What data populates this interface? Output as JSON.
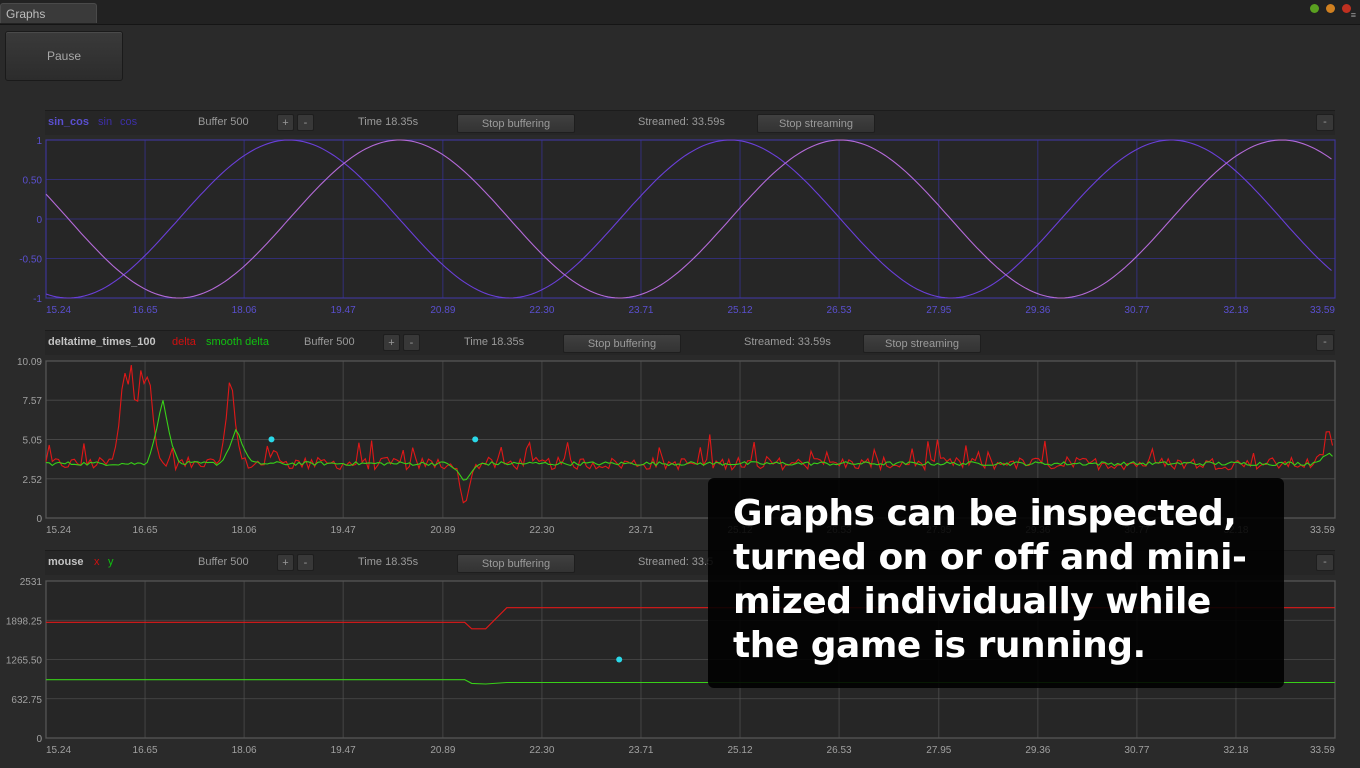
{
  "window": {
    "tab_label": "Graphs"
  },
  "pause_label": "Pause",
  "graphs": [
    {
      "name": "sin_cos",
      "series": [
        {
          "name": "sin",
          "color": "#3d2fa8"
        },
        {
          "name": "cos",
          "color": "#3d2fa8"
        }
      ],
      "buffer_label": "Buffer 500",
      "plus_label": "+",
      "minus_label": "-",
      "time_label": "Time 18.35s",
      "stop_buffering_label": "Stop buffering",
      "streamed_label": "Streamed: 33.59s",
      "stop_streaming_label": "Stop streaming",
      "minimize_label": "-"
    },
    {
      "name": "deltatime_times_100",
      "series": [
        {
          "name": "delta",
          "color": "#d01010"
        },
        {
          "name": "smooth delta",
          "color": "#10c010"
        }
      ],
      "buffer_label": "Buffer 500",
      "plus_label": "+",
      "minus_label": "-",
      "time_label": "Time 18.35s",
      "stop_buffering_label": "Stop buffering",
      "streamed_label": "Streamed: 33.59s",
      "stop_streaming_label": "Stop streaming",
      "minimize_label": "-"
    },
    {
      "name": "mouse",
      "series": [
        {
          "name": "x",
          "color": "#d01010"
        },
        {
          "name": "y",
          "color": "#10c010"
        }
      ],
      "buffer_label": "Buffer 500",
      "plus_label": "+",
      "minus_label": "-",
      "time_label": "Time 18.35s",
      "stop_buffering_label": "Stop buffering",
      "streamed_label": "Streamed: 33.5",
      "minimize_label": "-"
    }
  ],
  "overlay": {
    "text": "Graphs can be inspected, turned on or off and mini-mized individually while the game is running."
  },
  "chart_data": [
    {
      "type": "line",
      "name": "sin_cos",
      "x_ticks": [
        "15.24",
        "16.65",
        "18.06",
        "19.47",
        "20.89",
        "22.30",
        "23.71",
        "25.12",
        "26.53",
        "27.95",
        "29.36",
        "30.77",
        "32.18",
        "33.59"
      ],
      "y_ticks": [
        "1",
        "0.50",
        "0",
        "-0.50",
        "-1"
      ],
      "xlim": [
        15.24,
        33.59
      ],
      "ylim": [
        -1,
        1
      ],
      "grid_color": "#3b34a8",
      "tick_color": "#5a4fcf",
      "series": [
        {
          "name": "sin",
          "color": "#6a3fd8",
          "func": "sin",
          "peaks": [
            18.7,
            25.12,
            31.4
          ],
          "period": 6.28
        },
        {
          "name": "cos",
          "color": "#b46ad8",
          "func": "cos",
          "peaks": [
            20.27,
            26.55,
            32.8
          ],
          "period": 6.28
        }
      ],
      "markers": []
    },
    {
      "type": "line",
      "name": "deltatime_times_100",
      "x_ticks": [
        "15.24",
        "16.65",
        "18.06",
        "19.47",
        "20.89",
        "22.30",
        "23.71",
        "25.12",
        "26.53",
        "27.95",
        "29.36",
        "30.77",
        "32.18",
        "33.59"
      ],
      "y_ticks": [
        "10.09",
        "7.57",
        "5.05",
        "2.52",
        "0"
      ],
      "xlim": [
        15.24,
        33.59
      ],
      "ylim": [
        0,
        10.09
      ],
      "grid_color": "#555555",
      "tick_color": "#a0a0a0",
      "series": [
        {
          "name": "delta",
          "color": "#e01818",
          "baseline": 3.5,
          "noise": 0.8,
          "spikes": [
            [
              16.35,
              10.09
            ],
            [
              16.45,
              10.09
            ],
            [
              16.6,
              10.09
            ],
            [
              16.7,
              10.09
            ],
            [
              17.87,
              10.09
            ],
            [
              18.5,
              4.5
            ],
            [
              21.2,
              0.2
            ],
            [
              33.5,
              5.8
            ]
          ]
        },
        {
          "name": "smooth delta",
          "color": "#38d018",
          "baseline": 3.5,
          "noise": 0.25,
          "spikes": [
            [
              16.9,
              7.7
            ],
            [
              17.95,
              5.8
            ],
            [
              21.2,
              2.3
            ],
            [
              33.5,
              4.2
            ]
          ]
        }
      ],
      "markers": [
        [
          18.45,
          5.05
        ],
        [
          21.35,
          5.05
        ]
      ]
    },
    {
      "type": "line",
      "name": "mouse",
      "x_ticks": [
        "15.24",
        "16.65",
        "18.06",
        "19.47",
        "20.89",
        "22.30",
        "23.71",
        "25.12",
        "26.53",
        "27.95",
        "29.36",
        "30.77",
        "32.18",
        "33.59"
      ],
      "y_ticks": [
        "2531",
        "1898.25",
        "1265.50",
        "632.75",
        "0"
      ],
      "xlim": [
        15.24,
        33.59
      ],
      "ylim": [
        0,
        2531
      ],
      "grid_color": "#555555",
      "tick_color": "#a0a0a0",
      "series": [
        {
          "name": "x",
          "color": "#e01818",
          "points": [
            [
              15.24,
              1865
            ],
            [
              21.2,
              1865
            ],
            [
              21.3,
              1760
            ],
            [
              21.5,
              1760
            ],
            [
              21.8,
              2100
            ],
            [
              33.59,
              2100
            ]
          ]
        },
        {
          "name": "y",
          "color": "#38d018",
          "points": [
            [
              15.24,
              940
            ],
            [
              21.2,
              940
            ],
            [
              21.3,
              880
            ],
            [
              21.5,
              870
            ],
            [
              21.8,
              895
            ],
            [
              33.59,
              895
            ]
          ]
        }
      ],
      "markers": [
        [
          23.4,
          1265
        ]
      ]
    }
  ]
}
